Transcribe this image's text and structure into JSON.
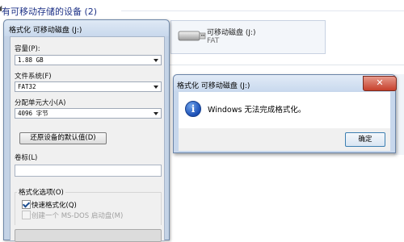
{
  "explorer": {
    "group_header": "有可移动存储的设备 (2)",
    "drive": {
      "name": "可移动磁盘 (J:)",
      "filesystem": "FAT"
    }
  },
  "format_dialog": {
    "title": "格式化 可移动磁盘 (J:)",
    "capacity_label": "容量(P):",
    "capacity_value": "1.88 GB",
    "filesystem_label": "文件系统(F)",
    "filesystem_value": "FAT32",
    "allocation_label": "分配单元大小(A)",
    "allocation_value": "4096 字节",
    "restore_button": "还原设备的默认值(D)",
    "volume_label_label": "卷标(L)",
    "volume_label_value": "",
    "options_label": "格式化选项(O)",
    "quick_format_label": "快速格式化(Q)",
    "quick_format_checked": true,
    "msdos_label": "创建一个 MS-DOS 启动盘(M)",
    "msdos_checked": false
  },
  "message_box": {
    "title": "格式化 可移动磁盘 (J:)",
    "close_glyph": "✕",
    "icon": "info-icon",
    "message": "Windows 无法完成格式化。",
    "ok_button": "确定"
  }
}
